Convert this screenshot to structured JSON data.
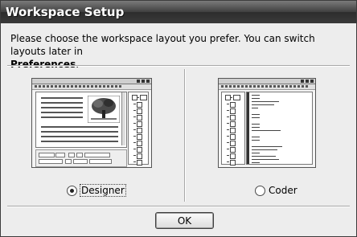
{
  "window": {
    "title": "Workspace Setup"
  },
  "instructions": {
    "text": "Please choose the workspace layout you prefer. You can switch layouts later in",
    "emphasis": "Preferences",
    "end": "."
  },
  "options": {
    "designer": {
      "label": "Designer",
      "selected": true
    },
    "coder": {
      "label": "Coder",
      "selected": false
    }
  },
  "buttons": {
    "ok_label": "OK"
  },
  "icons": {
    "designer_preview": "designer-layout-preview-icon",
    "coder_preview": "coder-layout-preview-icon"
  }
}
